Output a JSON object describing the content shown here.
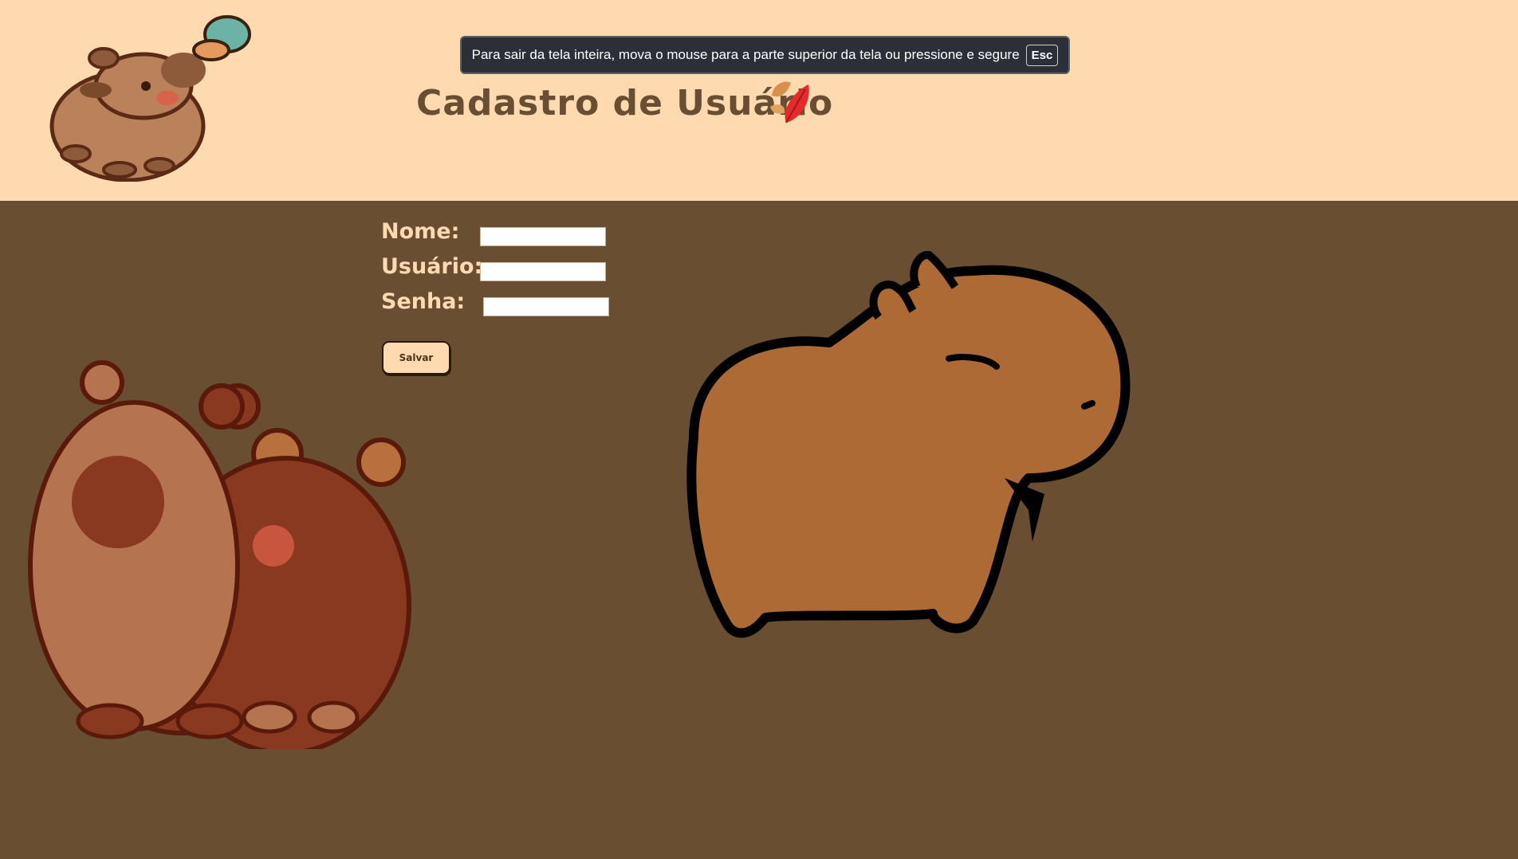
{
  "header": {
    "title": "Cadastro de Usuário",
    "bg_color": "#ffdab1",
    "title_color": "#6a4e31"
  },
  "fullscreen_banner": {
    "message": "Para sair da tela inteira, mova o mouse para a parte superior da tela ou pressione e segure",
    "key": "Esc"
  },
  "form": {
    "nome_label": "Nome:",
    "usuario_label": "Usuário:",
    "senha_label": "Senha:",
    "nome_value": "",
    "usuario_value": "",
    "senha_value": "",
    "save_label": "Salvar"
  },
  "colors": {
    "page_bg": "#6a4e31",
    "label": "#ffdab1",
    "capybara_fill": "#ae6a35"
  },
  "icons": [
    "capybara-butterfly-logo-icon",
    "autumn-leaf-icon",
    "capybara-couple-illustration",
    "capybara-drawing-illustration"
  ]
}
